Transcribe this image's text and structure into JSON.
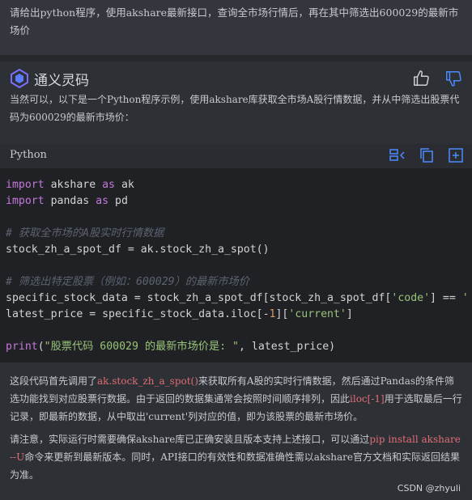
{
  "user_message": "请给出python程序，使用akshare最新接口，查询全市场行情后，再在其中筛选出600029的最新市场价",
  "assistant": {
    "name": "通义灵码",
    "intro": "当然可以，以下是一个Python程序示例，使用akshare库获取全市场A股行情数据，并从中筛选出股票代码为600029的最新市场价：",
    "code_language": "Python",
    "explain_p1_a": "这段代码首先调用了",
    "explain_p1_code1": "ak.stock_zh_a_spot()",
    "explain_p1_b": "来获取所有A股的实时行情数据，然后通过Pandas的条件筛选功能找到对应股票行数据。由于返回的数据集通常会按照时间顺序排列，因此",
    "explain_p1_code2": "iloc[-1]",
    "explain_p1_c": "用于选取最后一行记录，即最新的数据，从中取出'current'列对应的值，即为该股票的最新市场价。",
    "explain_p2_a": "请注意，实际运行时需要确保akshare库已正确安装且版本支持上述接口，可以通过",
    "explain_p2_code": "pip install akshare --U",
    "explain_p2_b": "命令来更新到最新版本。同时，API接口的有效性和数据准确性需以akshare官方文档和实际返回结果为准。"
  },
  "code": {
    "l1_kw": "import",
    "l1_mod": " akshare ",
    "l1_kw2": "as",
    "l1_alias": " ak",
    "l2_kw": "import",
    "l2_mod": " pandas ",
    "l2_kw2": "as",
    "l2_alias": " pd",
    "l3_comment": "# 获取全市场的A股实时行情数据",
    "l4": "stock_zh_a_spot_df = ak.stock_zh_a_spot()",
    "l5_comment": "# 筛选出特定股票（例如：600029）的最新市场价",
    "l6_a": "specific_stock_data = stock_zh_a_spot_df[stock_zh_a_spot_df[",
    "l6_str": "'code'",
    "l6_b": "] == ",
    "l6_str2": "'",
    "l7_a": "latest_price = specific_stock_data.iloc[-",
    "l7_num": "1",
    "l7_b": "][",
    "l7_str": "'current'",
    "l7_c": "]",
    "l8_kw": "print",
    "l8_open": "(",
    "l8_str": "\"股票代码 600029 的最新市场价是: \"",
    "l8_rest": ", latest_price)"
  },
  "watermark": "CSDN @zhyuli",
  "colors": {
    "accent": "#4a8cff",
    "keyword": "#c678dd",
    "string": "#98c379",
    "comment": "#5c6370"
  },
  "icons": [
    "logo-icon",
    "thumbs-up-icon",
    "thumbs-down-icon",
    "insert-code-icon",
    "copy-icon",
    "new-file-icon"
  ]
}
